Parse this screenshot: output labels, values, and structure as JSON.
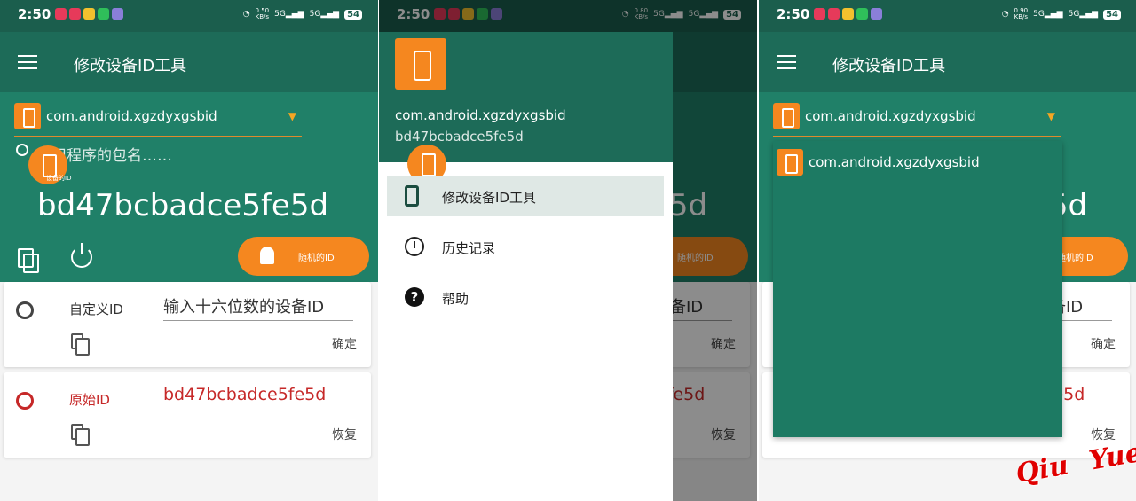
{
  "status_bar": {
    "time": "2:50",
    "battery": "54",
    "signal": "5G",
    "speeds": [
      "0.50",
      "0.80",
      "0.90"
    ],
    "speed_unit": "KB/s"
  },
  "app": {
    "title": "修改设备ID工具",
    "package": "com.android.xgzdyxgsbid",
    "search_hint": "用程序的包名……",
    "current_id_label": "设备的ID",
    "device_id": "bd47bcbadce5fe5d",
    "random_button": "随机的ID"
  },
  "custom_row": {
    "label": "自定义ID",
    "placeholder": "输入十六位数的设备ID",
    "action": "确定"
  },
  "original_row": {
    "label": "原始ID",
    "value": "bd47bcbadce5fe5d",
    "action": "恢复"
  },
  "drawer": {
    "package": "com.android.xgzdyxgsbid",
    "device_id": "bd47bcbadce5fe5d",
    "items": [
      {
        "label": "修改设备ID工具",
        "icon": "phone-icon"
      },
      {
        "label": "历史记录",
        "icon": "history-icon"
      },
      {
        "label": "帮助",
        "icon": "help-icon"
      }
    ]
  },
  "dropdown": {
    "options": [
      "com.android.xgzdyxgsbid"
    ]
  },
  "watermark": "Qiu  Yue",
  "colors": {
    "primary_dark": "#1d6b58",
    "primary": "#208068",
    "accent": "#f5871f",
    "error": "#c62828"
  }
}
